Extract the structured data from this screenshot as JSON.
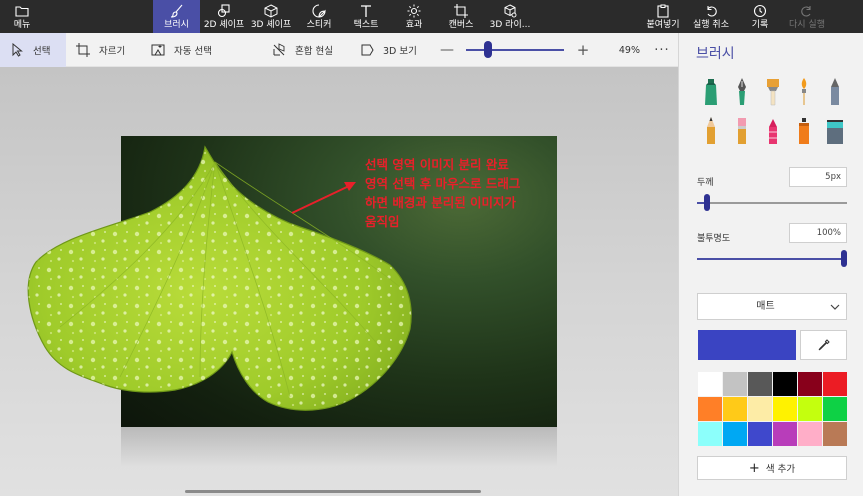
{
  "ribbon": {
    "menu": "메뉴",
    "brush": "브러시",
    "shapes2d": "2D 셰이프",
    "shapes3d": "3D 셰이프",
    "sticker": "스티커",
    "text": "텍스트",
    "effects": "효과",
    "canvas": "캔버스",
    "library3d": "3D 라이...",
    "paste": "붙여넣기",
    "undo": "실행 취소",
    "history": "기록",
    "redo": "다시 실행"
  },
  "toolbar": {
    "select": "선택",
    "crop": "자르기",
    "magic_select": "자동 선택",
    "mixed_reality": "혼합 현실",
    "view3d": "3D 보기",
    "zoom_minus": "—",
    "zoom_plus": "+",
    "zoom_value": "49%",
    "zoom_level": 0.2,
    "more": "···"
  },
  "canvas": {
    "annotation": [
      "선택 영역 이미지 분리 완료",
      "영역 선택 후 마우스로 드래그",
      "하면 배경과 분리된 이미지가",
      "움직임"
    ],
    "annotation_color": "#e8202a"
  },
  "panel": {
    "title": "브러시",
    "thickness_label": "두께",
    "thickness_value": "5px",
    "thickness_level": 0.05,
    "opacity_label": "불투명도",
    "opacity_value": "100%",
    "opacity_level": 1.0,
    "texture": "매트",
    "current_color": "#3a44c2",
    "add_color": "색 추가",
    "palette": [
      "#ffffff",
      "#c3c3c3",
      "#585858",
      "#000000",
      "#88001b",
      "#ec1c24",
      "#ff7f27",
      "#ffca18",
      "#fdeca6",
      "#fff200",
      "#c4ff0e",
      "#0ed145",
      "#8cfffb",
      "#00a8f3",
      "#3f48cc",
      "#b83dba",
      "#ffaec8",
      "#b97a56"
    ]
  },
  "accent": "#4a4fa6"
}
